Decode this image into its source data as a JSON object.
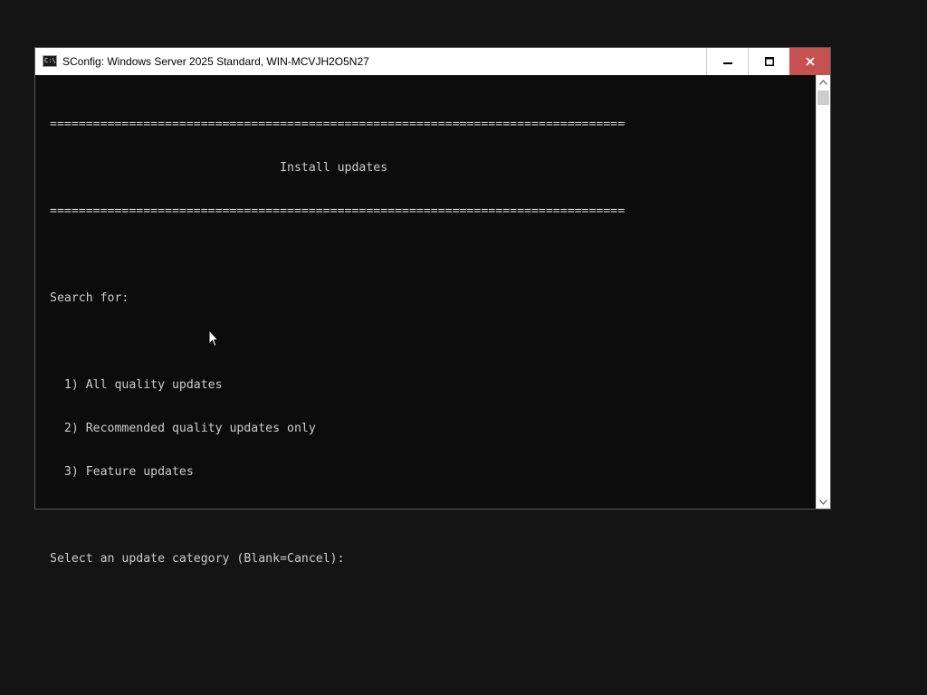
{
  "window": {
    "title": "SConfig: Windows Server 2025 Standard, WIN-MCVJH2O5N27",
    "icon_text": "C:\\",
    "icons": {
      "app": "console-icon",
      "minimize": "minimize-icon",
      "maximize": "maximize-icon",
      "close": "close-icon"
    },
    "colors": {
      "titlebar": "#ffffff",
      "close_button": "#c75050",
      "console_background": "#0c0c0c",
      "console_text": "#cccccc",
      "desktop": "#141414"
    }
  },
  "console": {
    "lines": [
      "================================================================================",
      "                                Install updates",
      "================================================================================",
      "",
      "Search for:",
      "",
      "  1) All quality updates",
      "  2) Recommended quality updates only",
      "  3) Feature updates",
      "",
      "Select an update category (Blank=Cancel):"
    ]
  },
  "scrollbar": {
    "up_icon": "chevron-up-icon",
    "down_icon": "chevron-down-icon"
  },
  "cursor": {
    "icon": "mouse-pointer-icon"
  }
}
